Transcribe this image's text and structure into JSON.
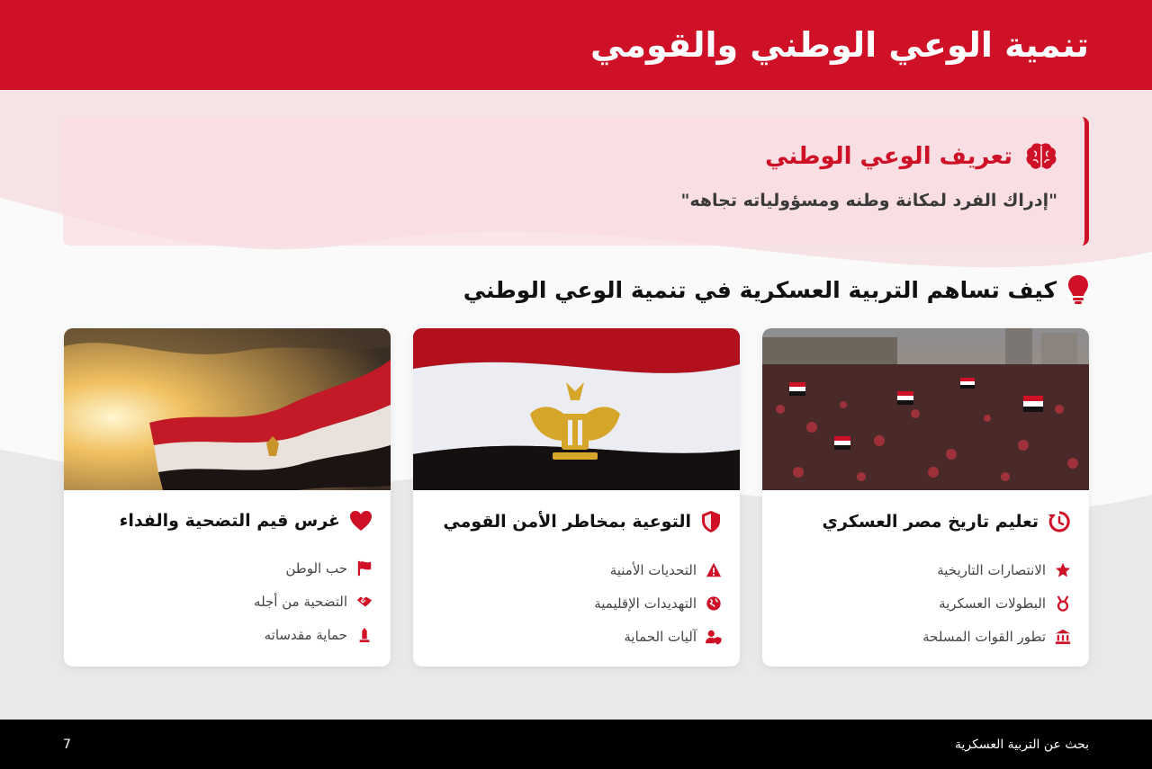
{
  "header": {
    "title": "تنمية الوعي الوطني والقومي"
  },
  "definition": {
    "icon": "brain-icon",
    "title": "تعريف الوعي الوطني",
    "text": "\"إدراك الفرد لمكانة وطنه ومسؤولياته تجاهه\""
  },
  "section": {
    "icon": "lightbulb-icon",
    "title": "كيف تساهم التربية العسكرية في تنمية الوعي الوطني"
  },
  "cards": [
    {
      "image": "crowd-with-flags-photo",
      "icon": "history-icon",
      "title": "تعليم تاريخ مصر العسكري",
      "items": [
        {
          "icon": "star-icon",
          "label": "الانتصارات التاريخية"
        },
        {
          "icon": "medal-icon",
          "label": "البطولات العسكرية"
        },
        {
          "icon": "landmark-icon",
          "label": "تطور القوات المسلحة"
        }
      ]
    },
    {
      "image": "flag-with-eagle-photo",
      "icon": "shield-icon",
      "title": "التوعية بمخاطر الأمن القومي",
      "items": [
        {
          "icon": "warning-icon",
          "label": "التحديات الأمنية"
        },
        {
          "icon": "globe-icon",
          "label": "التهديدات الإقليمية"
        },
        {
          "icon": "user-shield-icon",
          "label": "آليات الحماية"
        }
      ]
    },
    {
      "image": "flag-at-sunset-photo",
      "icon": "heart-icon",
      "title": "غرس قيم التضحية والفداء",
      "items": [
        {
          "icon": "flag-icon",
          "label": "حب الوطن"
        },
        {
          "icon": "handshake-icon",
          "label": "التضحية من أجله"
        },
        {
          "icon": "monument-icon",
          "label": "حماية مقدساته"
        }
      ]
    }
  ],
  "footer": {
    "label": "بحث عن التربية العسكرية",
    "page": "7"
  },
  "colors": {
    "accent": "#ce1126",
    "dark": "#000000",
    "tint": "#fadee2"
  }
}
